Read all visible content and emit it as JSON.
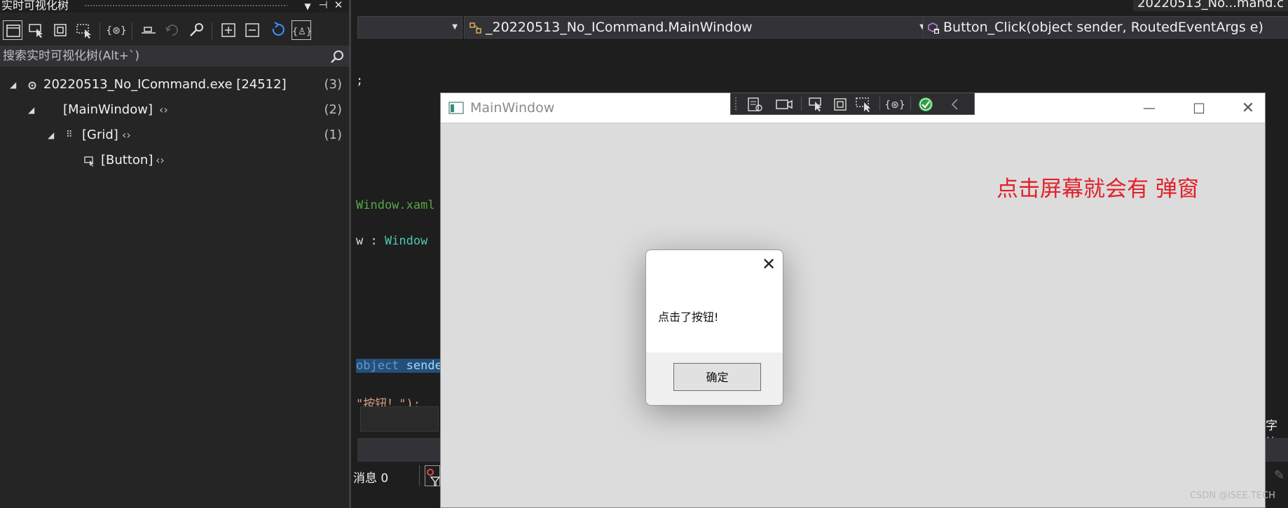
{
  "live_tree": {
    "title": "实时可视化树",
    "search_placeholder": "搜索实时可视化树(Alt+`)",
    "nodes": [
      {
        "label": "20220513_No_ICommand.exe [24512]",
        "count": "(3)"
      },
      {
        "label": "[MainWindow]",
        "count": "(2)"
      },
      {
        "label": "[Grid]",
        "count": "(1)"
      },
      {
        "label": "[Button]",
        "count": ""
      }
    ]
  },
  "editor": {
    "tab_title": "20220513_No...mand.c",
    "nav_class": "_20220513_No_ICommand.MainWindow",
    "nav_member": "Button_Click(object sender, RoutedEventArgs e)",
    "code_snippets": {
      "semicolon": ";",
      "xaml_comment": "Window.xaml",
      "class_decl_a": "w : ",
      "class_decl_b": "Window",
      "param_a": "object",
      "param_b": " sende",
      "string_literal": "\"按钮！\");",
      "messages": "消息 0",
      "right_status": "字符:"
    }
  },
  "main_window": {
    "title": "MainWindow",
    "red_text": "点击屏幕就会有 弹窗"
  },
  "dialog": {
    "message": "点击了按钮!",
    "ok_label": "确定",
    "close_glyph": "✕"
  },
  "watermark": "CSDN @ISEE.TECH",
  "colors": {
    "red_text": "#e3202a",
    "code_comment": "#57a64a",
    "code_type": "#4ec9b0",
    "code_keyword": "#569cd6",
    "code_string": "#d69d85"
  }
}
